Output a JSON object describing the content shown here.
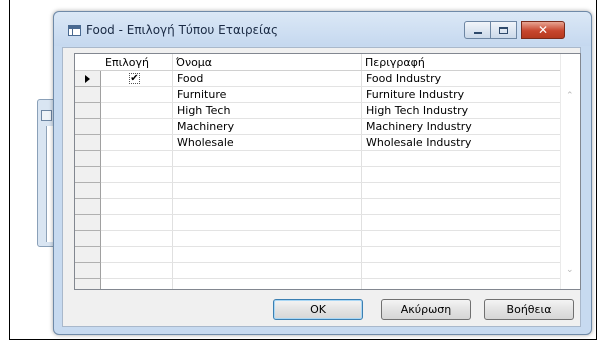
{
  "window": {
    "title": "Food - Επιλογή Τύπου Εταιρείας",
    "close_glyph": "✕"
  },
  "grid": {
    "columns": [
      "Επιλογή",
      "Όνομα",
      "Περιγραφή"
    ],
    "rows": [
      {
        "selected": true,
        "current": true,
        "name": "Food",
        "description": "Food Industry"
      },
      {
        "selected": false,
        "current": false,
        "name": "Furniture",
        "description": "Furniture Industry"
      },
      {
        "selected": false,
        "current": false,
        "name": "High Tech",
        "description": "High Tech Industry"
      },
      {
        "selected": false,
        "current": false,
        "name": "Machinery",
        "description": "Machinery Industry"
      },
      {
        "selected": false,
        "current": false,
        "name": "Wholesale",
        "description": "Wholesale Industry"
      }
    ],
    "check_glyph": "✔",
    "scroll_up": "⌃",
    "scroll_down": "⌄"
  },
  "buttons": {
    "ok": "OK",
    "cancel": "Ακύρωση",
    "help": "Βοήθεια"
  },
  "icons": {
    "title": "table-window-icon",
    "row_pointer": "triangle-right-icon"
  }
}
